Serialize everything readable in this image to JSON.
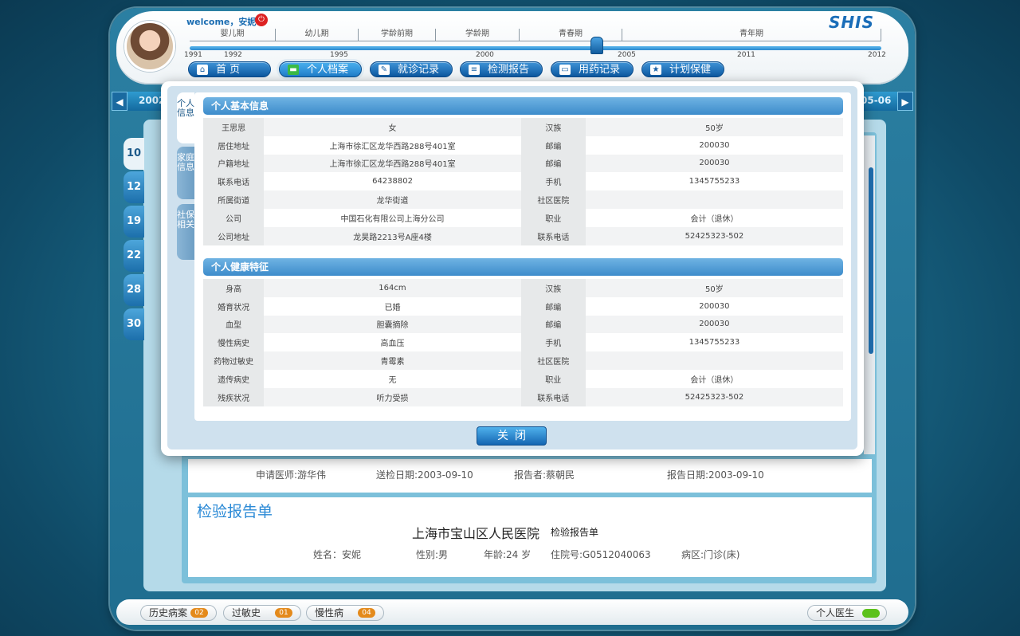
{
  "header": {
    "welcome": "welcome，安妮",
    "logo": "SHIS",
    "stages": [
      "婴儿期",
      "幼儿期",
      "学龄前期",
      "学龄期",
      "青春期",
      "青年期"
    ],
    "years": [
      "1991",
      "1992",
      "1995",
      "2000",
      "2005",
      "2011",
      "2012"
    ]
  },
  "nav": [
    "首 页",
    "个人档案",
    "就诊记录",
    "检测报告",
    "用药记录",
    "计划保健"
  ],
  "date_bar": {
    "left": "2002",
    "right": "05-06"
  },
  "days": [
    "10",
    "12",
    "19",
    "22",
    "28",
    "30"
  ],
  "modal": {
    "tabs": [
      "个人信息",
      "家庭信息",
      "社保相关"
    ],
    "basic_title": "个人基本信息",
    "basic_rows": [
      [
        "王思思",
        "女",
        "汉族",
        "50岁"
      ],
      [
        "居住地址",
        "上海市徐汇区龙华西路288号401室",
        "邮编",
        "200030"
      ],
      [
        "户籍地址",
        "上海市徐汇区龙华西路288号401室",
        "邮编",
        "200030"
      ],
      [
        "联系电话",
        "64238802",
        "手机",
        "1345755233"
      ],
      [
        "所属街道",
        "龙华街道",
        "社区医院",
        ""
      ],
      [
        "公司",
        "中国石化有限公司上海分公司",
        "职业",
        "会计（退休）"
      ],
      [
        "公司地址",
        "龙昊路2213号A座4楼",
        "联系电话",
        "52425323-502"
      ]
    ],
    "health_title": "个人健康特征",
    "health_rows": [
      [
        "身高",
        "164cm",
        "汉族",
        "50岁"
      ],
      [
        "婚育状况",
        "已婚",
        "邮编",
        "200030"
      ],
      [
        "血型",
        "胆囊摘除",
        "邮编",
        "200030"
      ],
      [
        "慢性病史",
        "高血压",
        "手机",
        "1345755233"
      ],
      [
        "药物过敏史",
        "青霉素",
        "社区医院",
        ""
      ],
      [
        "遗传病史",
        "无",
        "职业",
        "会计（退休）"
      ],
      [
        "残疾状况",
        "听力受损",
        "联系电话",
        "52425323-502"
      ]
    ],
    "close": "关闭"
  },
  "report": {
    "doctor": "申请医师:游华伟",
    "send_date": "送检日期:2003-09-10",
    "reporter": "报告者:蔡朝民",
    "report_date": "报告日期:2003-09-10",
    "card_title": "检验报告单",
    "hospital": "上海市宝山区人民医院",
    "hospital_sub": "检验报告单",
    "name": "姓名：安妮",
    "gender": "性别:男",
    "age": "年龄:24 岁",
    "inpatient": "住院号:G0512040063",
    "ward": "病区:门诊(床)"
  },
  "bottom": [
    {
      "label": "历史病案",
      "badge": "02"
    },
    {
      "label": "过敏史",
      "badge": "01"
    },
    {
      "label": "慢性病",
      "badge": "04"
    }
  ],
  "doctor_pill": "个人医生"
}
